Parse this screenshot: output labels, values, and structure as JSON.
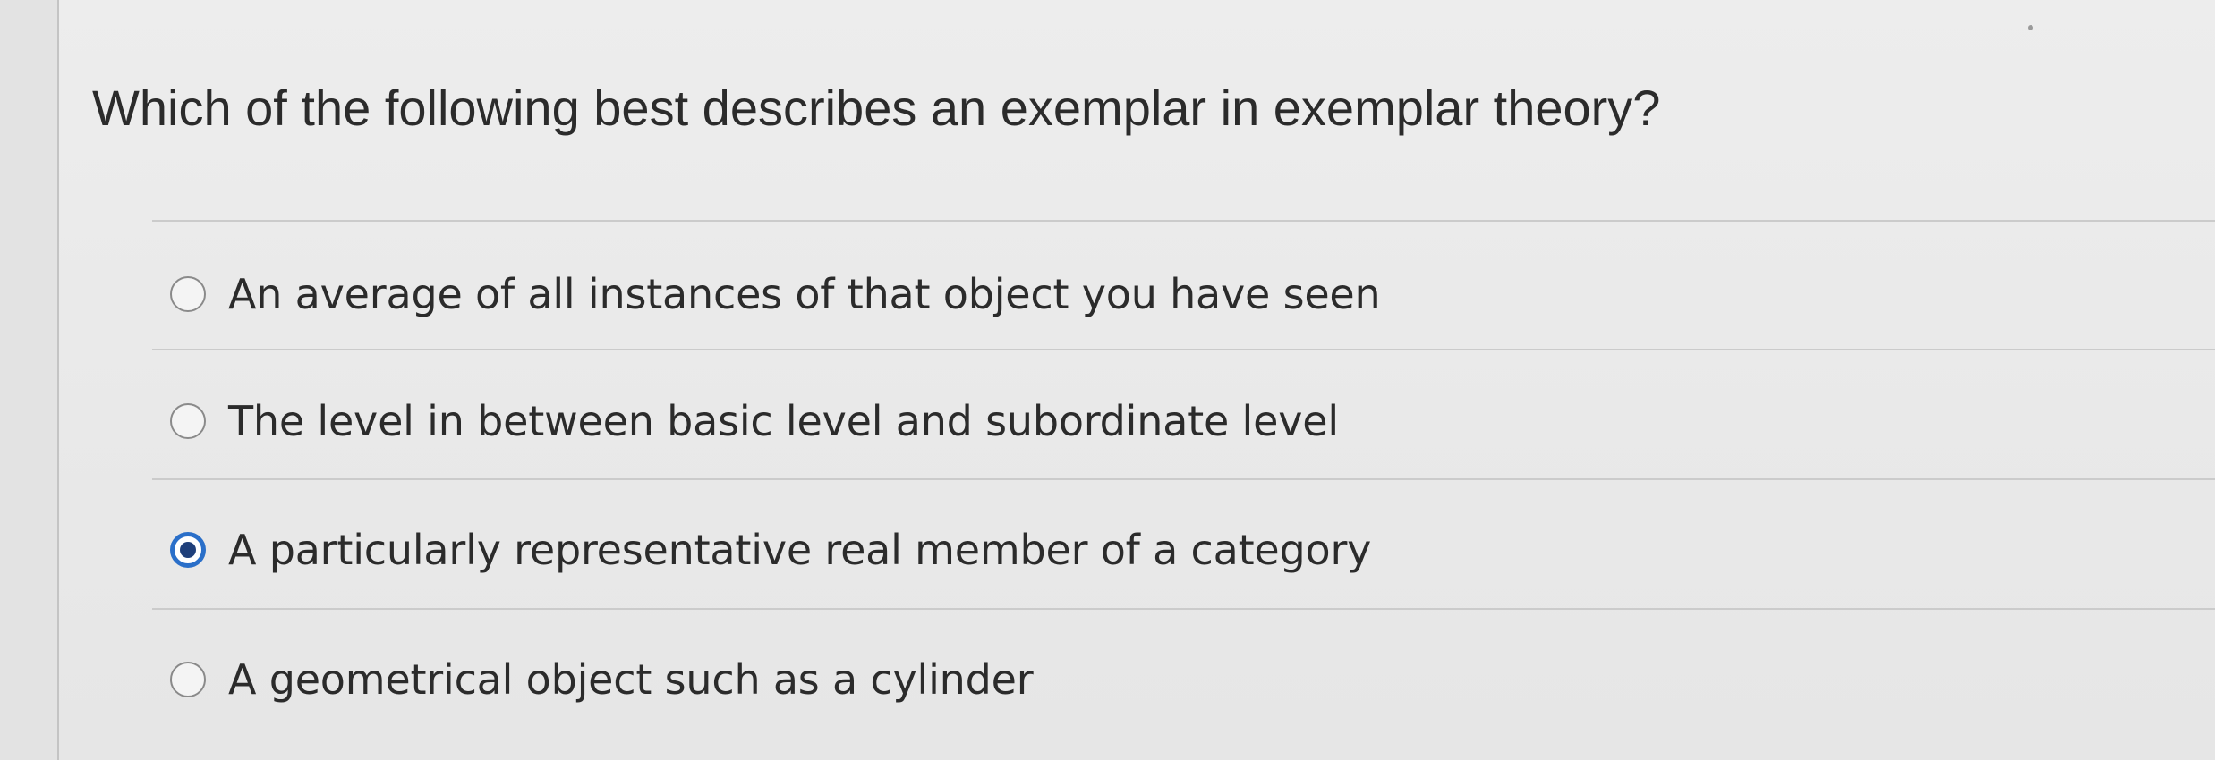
{
  "question": {
    "text": "Which of the following best describes an exemplar in exemplar theory?"
  },
  "options": [
    {
      "label": "An average of all instances of that object you have seen",
      "selected": false
    },
    {
      "label": "The level in between basic level and subordinate level",
      "selected": false
    },
    {
      "label": "A particularly representative real member of a category",
      "selected": true
    },
    {
      "label": "A geometrical object such as a cylinder",
      "selected": false
    }
  ],
  "colors": {
    "selected_radio_ring": "#2a6fc9",
    "selected_radio_dot": "#1f3f7a",
    "text": "#2b2b2b",
    "divider": "#cbcbcb"
  }
}
